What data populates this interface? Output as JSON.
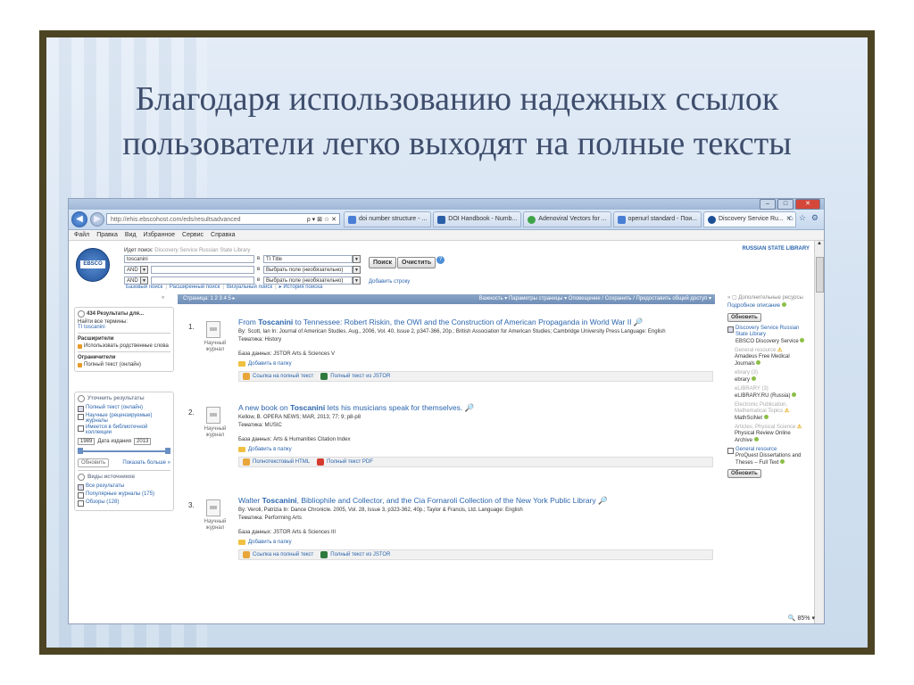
{
  "slide": {
    "title_lines": [
      "Благодаря использованию надежных ссылок",
      "пользователи легко выходят на полные тексты"
    ]
  },
  "colors": {
    "frame": "#4d4424",
    "link": "#2b65ae",
    "title": "#3e4d6c"
  },
  "browser": {
    "address": "http://ehis.ebscohost.com/eds/resultsadvanced",
    "address_controls": "ρ ▾ ⊠ ☆ ✕",
    "tabs": [
      {
        "label": "doi number structure - ...",
        "icon": "google-icon"
      },
      {
        "label": "DOI Handbook - Numb...",
        "icon": "doi-icon"
      },
      {
        "label": "Adenoviral Vectors for ...",
        "icon": "green-icon"
      },
      {
        "label": "openurl standard - Пои...",
        "icon": "google-icon"
      },
      {
        "label": "Discovery Service Ru...",
        "icon": "ebsco-icon",
        "active": true
      }
    ],
    "menu": [
      "Файл",
      "Правка",
      "Вид",
      "Избранное",
      "Сервис",
      "Справка"
    ],
    "zoom": "85%"
  },
  "search": {
    "logo_text": "EBSCO",
    "searching_label": "Идет поиск:",
    "searching_value": "Discovery Service Russian State Library",
    "term": "toscanini",
    "bool1": "AND",
    "bool2": "AND",
    "in_label": "в",
    "field1": "TI Title",
    "field2": "Выбрать поле (необязательно)",
    "field3": "Выбрать поле (необязательно)",
    "search_btn": "Поиск",
    "clear_btn": "Очистить",
    "add_row": "Добавить строку",
    "links": [
      "Базовый поиск",
      "Расширенный поиск",
      "Визуальный поиск",
      "История поиска"
    ],
    "library": "RUSSIAN STATE LIBRARY"
  },
  "toolbar": {
    "pages": "Страница: 1 2 3 4 5 ▸",
    "options": "Важность ▾   Параметры страницы ▾   Оповещение / Сохранить / Предоставить общий доступ ▾"
  },
  "left": {
    "count": "434 Результаты для...",
    "find_all": "Найти все термины:",
    "query": "TI toscanini",
    "expanders_title": "Расширители",
    "expander1": "Использовать родственные слова",
    "limiters_title": "Ограничители",
    "limiter1": "Полный текст (онлайн)",
    "refine_title": "Уточнить результаты",
    "refine_items": [
      "Полный текст (онлайн)",
      "Научные (рецензируемые) журналы",
      "Имеется в библиотечной коллекции"
    ],
    "year_from": "1989",
    "year_label": "Дата издания",
    "year_to": "2013",
    "refresh_btn": "Обновить",
    "show_more": "Показать больше »",
    "source_title": "Виды источников",
    "sources": [
      "Все результаты",
      "Популярные журналы (175)",
      "Обзоры (128)"
    ]
  },
  "results": [
    {
      "num": "1.",
      "type": "Научный журнал",
      "title_pre": "From ",
      "title_bold": "Toscanini",
      "title_post": " to Tennessee: Robert Riskin, the OWI and the Construction of American Propaganda in World War II",
      "byline": "By: Scott, Ian In: Journal of American Studies. Aug., 2006, Vol. 40, Issue 2, p347-366, 20p.; British Association for American Studies; Cambridge University Press Language: English",
      "subject": "Тематика: History",
      "database": "База данных: JSTOR Arts & Sciences V",
      "folder": "Добавить в папку",
      "link1": "Ссылка на полный текст",
      "link2": "Полный текст из JSTOR"
    },
    {
      "num": "2.",
      "type": "Научный журнал",
      "title_pre": "A new book on ",
      "title_bold": "Toscanini",
      "title_post": " lets his musicians speak for themselves.",
      "byline": "Kellow, B. OPERA NEWS; MAR, 2013; 77; 9; p8-p8",
      "subject": "Тематика: MUSIC",
      "database": "База данных: Arts & Humanities Citation Index",
      "folder": "Добавить в папку",
      "link1": "Полнотекстовый HTML",
      "link2": "Полный текст PDF"
    },
    {
      "num": "3.",
      "type": "Научный журнал",
      "title_pre": "Walter ",
      "title_bold": "Toscanini",
      "title_post": ", Bibliophile and Collector, and the Cia Fornaroli Collection of the New York Public Library",
      "byline": "By: Veroli, Patrizia In: Dance Chronicle. 2005, Vol. 28, Issue 3, p323-362, 40p.; Taylor & Francis, Ltd. Language: English",
      "subject": "Тематика: Performing Arts",
      "database": "База данных: JSTOR Arts & Sciences III",
      "folder": "Добавить в папку",
      "link1": "Ссылка на полный текст",
      "link2": "Полный текст из JSTOR"
    }
  ],
  "right": {
    "head": "Дополнительные ресурсы",
    "detail": "Подробное описание",
    "refresh_btn": "Обновить",
    "item1": "Discovery Service Russian State Library",
    "item1_sub": "EBSCO Discovery Service",
    "cat2": "General resource",
    "item2": "Amadeus Free Medical Journals",
    "cat3": "ebrary (3)",
    "item3": "ebrary",
    "cat4": "eLIBRARY (3)",
    "item4": "eLIBRARY.RU (Russia)",
    "cat5": "Electronic Publication, Mathematical Topics",
    "item5": "MathSciNet",
    "cat6": "Articles, Physical Science",
    "item6": "Physical Review Online Archive",
    "cat7": "General resource",
    "item7": "ProQuest Dissertations and Theses – Full Text",
    "refresh_btn2": "Обновить"
  }
}
